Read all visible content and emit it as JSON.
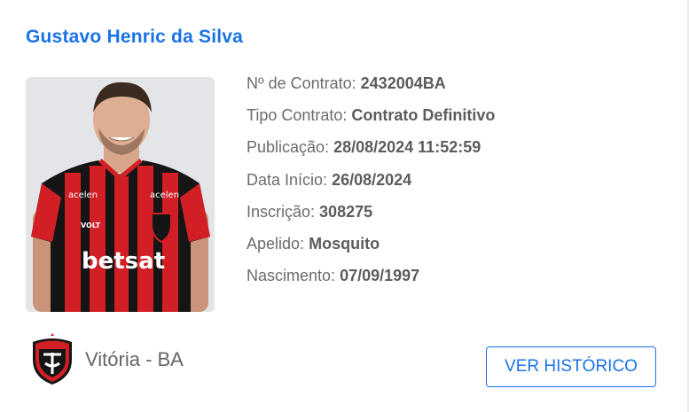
{
  "player": {
    "name": "Gustavo Henric da Silva",
    "details": [
      {
        "label": "Nº de Contrato:",
        "value": "2432004BA"
      },
      {
        "label": "Tipo Contrato:",
        "value": "Contrato Definitivo"
      },
      {
        "label": "Publicação:",
        "value": "28/08/2024 11:52:59"
      },
      {
        "label": "Data Início:",
        "value": "26/08/2024"
      },
      {
        "label": "Inscrição:",
        "value": "308275"
      },
      {
        "label": "Apelido:",
        "value": "Mosquito"
      },
      {
        "label": "Nascimento:",
        "value": "07/09/1997"
      }
    ],
    "photo_text": {
      "sponsor_left": "acelen",
      "sponsor_right": "acelen",
      "sleeve_brand": "VOLT",
      "main_sponsor": "betsat"
    }
  },
  "club": {
    "name": "Vitória - BA",
    "crest_icon": "vitoria-crest-icon"
  },
  "actions": {
    "history_label": "VER HISTÓRICO"
  },
  "colors": {
    "accent": "#1a73e8",
    "jersey_red": "#d21f26",
    "jersey_black": "#151515"
  }
}
